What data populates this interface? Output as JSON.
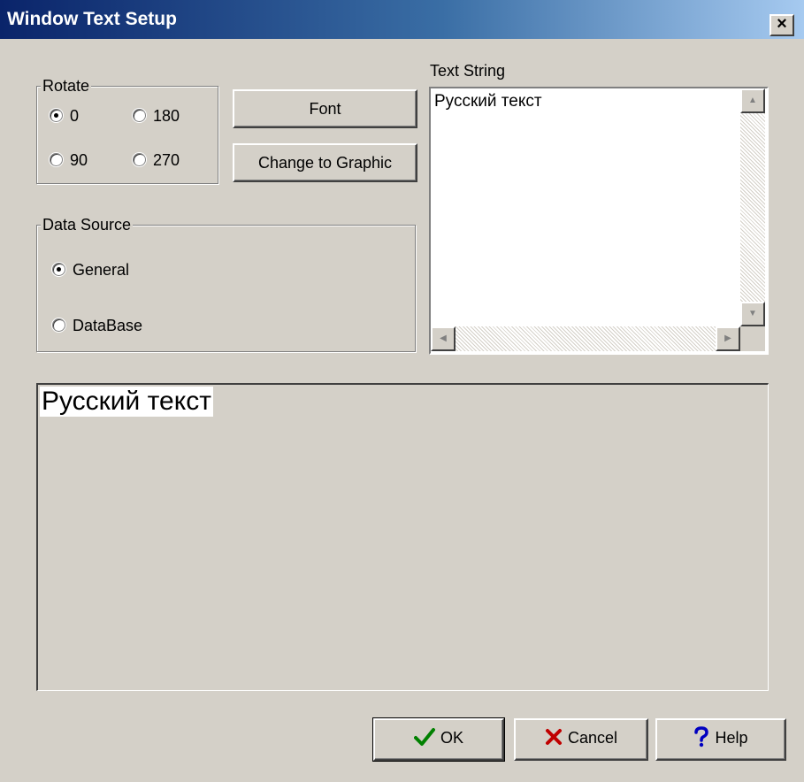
{
  "window": {
    "title": "Window Text Setup",
    "close_label": "×"
  },
  "rotate": {
    "legend": "Rotate",
    "options": [
      {
        "label": "0",
        "selected": true
      },
      {
        "label": "180",
        "selected": false
      },
      {
        "label": "90",
        "selected": false
      },
      {
        "label": "270",
        "selected": false
      }
    ]
  },
  "buttons": {
    "font": "Font",
    "change_to_graphic": "Change to Graphic",
    "ok": "OK",
    "cancel": "Cancel",
    "help": "Help"
  },
  "data_source": {
    "legend": "Data Source",
    "options": [
      {
        "label": "General",
        "selected": true
      },
      {
        "label": "DataBase",
        "selected": false
      }
    ]
  },
  "text_string": {
    "label": "Text String",
    "value": "Русский текст"
  },
  "preview": {
    "text": "Русский текст"
  },
  "colors": {
    "dialog_bg": "#d4d0c8",
    "title_start": "#0a246a",
    "title_end": "#a6caf0",
    "ok_check": "#008000",
    "cancel_x": "#c00000",
    "help_q": "#0000c0"
  },
  "icons": {
    "ok": "check-icon",
    "cancel": "x-icon",
    "help": "question-icon"
  }
}
